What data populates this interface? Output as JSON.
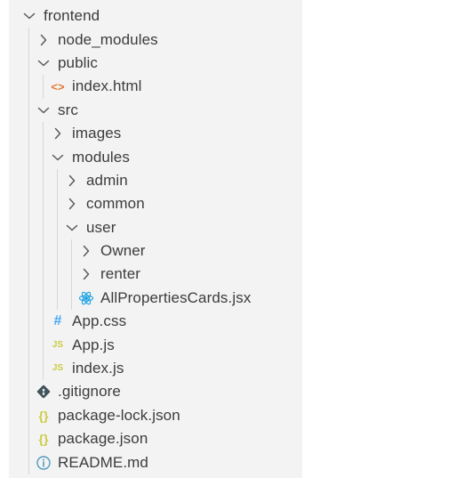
{
  "explorer": {
    "items": [
      {
        "label": "frontend",
        "depth": 0,
        "kind": "folder",
        "expanded": true,
        "icon": "chevron-down-icon"
      },
      {
        "label": "node_modules",
        "depth": 1,
        "kind": "folder",
        "expanded": false,
        "icon": "chevron-right-icon"
      },
      {
        "label": "public",
        "depth": 1,
        "kind": "folder",
        "expanded": true,
        "icon": "chevron-down-icon"
      },
      {
        "label": "index.html",
        "depth": 2,
        "kind": "file",
        "icon": "html-file-icon",
        "icon_text": "<>",
        "icon_color": "#e37933"
      },
      {
        "label": "src",
        "depth": 1,
        "kind": "folder",
        "expanded": true,
        "icon": "chevron-down-icon"
      },
      {
        "label": "images",
        "depth": 2,
        "kind": "folder",
        "expanded": false,
        "icon": "chevron-right-icon"
      },
      {
        "label": "modules",
        "depth": 2,
        "kind": "folder",
        "expanded": true,
        "icon": "chevron-down-icon"
      },
      {
        "label": "admin",
        "depth": 3,
        "kind": "folder",
        "expanded": false,
        "icon": "chevron-right-icon"
      },
      {
        "label": "common",
        "depth": 3,
        "kind": "folder",
        "expanded": false,
        "icon": "chevron-right-icon"
      },
      {
        "label": "user",
        "depth": 3,
        "kind": "folder",
        "expanded": true,
        "icon": "chevron-down-icon"
      },
      {
        "label": "Owner",
        "depth": 4,
        "kind": "folder",
        "expanded": false,
        "icon": "chevron-right-icon"
      },
      {
        "label": "renter",
        "depth": 4,
        "kind": "folder",
        "expanded": false,
        "icon": "chevron-right-icon"
      },
      {
        "label": "AllPropertiesCards.jsx",
        "depth": 4,
        "kind": "file",
        "icon": "react-file-icon",
        "icon_color": "#1ba1e2"
      },
      {
        "label": "App.css",
        "depth": 2,
        "kind": "file",
        "icon": "css-file-icon",
        "icon_text": "#",
        "icon_color": "#42a5f5"
      },
      {
        "label": "App.js",
        "depth": 2,
        "kind": "file",
        "icon": "js-file-icon",
        "icon_text": "JS",
        "icon_color": "#cbcb41"
      },
      {
        "label": "index.js",
        "depth": 2,
        "kind": "file",
        "icon": "js-file-icon",
        "icon_text": "JS",
        "icon_color": "#cbcb41"
      },
      {
        "label": ".gitignore",
        "depth": 1,
        "kind": "file",
        "icon": "git-file-icon",
        "icon_color": "#41535b"
      },
      {
        "label": "package-lock.json",
        "depth": 1,
        "kind": "file",
        "icon": "json-file-icon",
        "icon_text": "{}",
        "icon_color": "#cbcb41"
      },
      {
        "label": "package.json",
        "depth": 1,
        "kind": "file",
        "icon": "json-file-icon",
        "icon_text": "{}",
        "icon_color": "#cbcb41"
      },
      {
        "label": "README.md",
        "depth": 1,
        "kind": "file",
        "icon": "info-file-icon",
        "icon_color": "#519aba"
      }
    ]
  },
  "colors": {
    "panel_background": "#f3f3f3",
    "text": "#3c3c3c",
    "chevron": "#5a5a5a",
    "indent_guide": "#d6d6d6"
  }
}
